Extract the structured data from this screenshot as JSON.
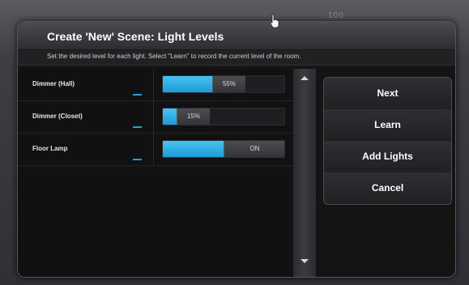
{
  "background": {
    "top_text": "100"
  },
  "dialog": {
    "title": "Create 'New' Scene: Light Levels",
    "subtitle": "Set the desired level for each light. Select \"Learn\" to record the current level of the room."
  },
  "lights": [
    {
      "label": "Dimmer (Hall)",
      "control": "dimmer",
      "level_percent": 55,
      "display": "55%"
    },
    {
      "label": "Dimmer (Closet)",
      "control": "dimmer",
      "level_percent": 15,
      "display": "15%"
    },
    {
      "label": "Floor Lamp",
      "control": "switch",
      "state": "on",
      "display": "ON"
    }
  ],
  "buttons": {
    "next": "Next",
    "learn": "Learn",
    "add_lights": "Add Lights",
    "cancel": "Cancel"
  },
  "colors": {
    "accent": "#2d9bd8",
    "slider_fill": "#3cb6ea",
    "dialog_background": "#141414",
    "title_text": "#ffffff"
  },
  "icons": {
    "scroll_up": "triangle-up-icon",
    "scroll_down": "triangle-down-icon",
    "mouse_cursor": "hand-pointer-icon"
  }
}
